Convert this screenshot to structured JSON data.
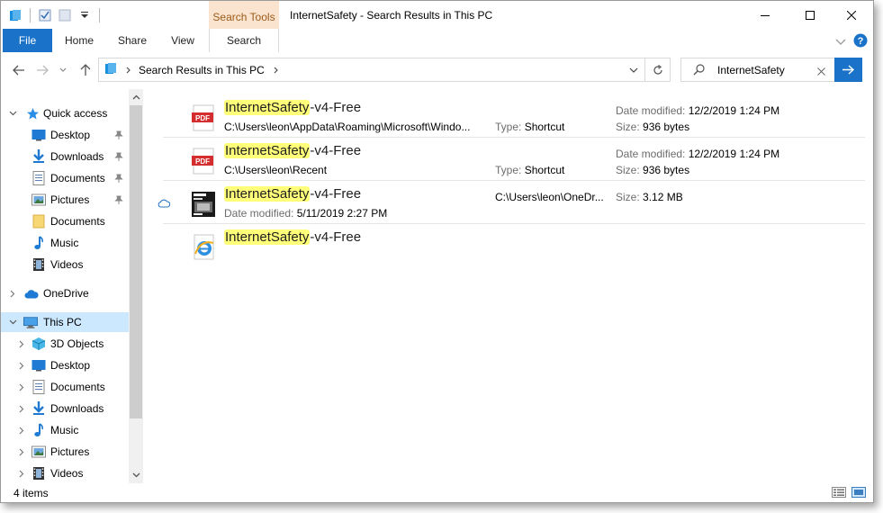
{
  "window": {
    "title": "InternetSafety - Search Results in This PC"
  },
  "ribbon": {
    "context_header": "Search Tools",
    "tabs": [
      "File",
      "Home",
      "Share",
      "View",
      "Search"
    ]
  },
  "address": {
    "breadcrumb": "Search Results in This PC"
  },
  "search": {
    "value": "InternetSafety"
  },
  "nav": {
    "quick_access": "Quick access",
    "quick_items": [
      "Desktop",
      "Downloads",
      "Documents",
      "Pictures",
      "Documents",
      "Music",
      "Videos"
    ],
    "onedrive": "OneDrive",
    "this_pc": "This PC",
    "pc_items": [
      "3D Objects",
      "Desktop",
      "Documents",
      "Downloads",
      "Music",
      "Pictures",
      "Videos"
    ]
  },
  "results": [
    {
      "name_highlight": "InternetSafety",
      "name_rest": "-v4-Free",
      "icon": "pdf-shortcut-icon",
      "path": "C:\\Users\\leon\\AppData\\Roaming\\Microsoft\\Windo...",
      "type_label": "Type:",
      "type": "Shortcut",
      "date_label": "Date modified:",
      "date": "12/2/2019 1:24 PM",
      "size_label": "Size:",
      "size": "936 bytes"
    },
    {
      "name_highlight": "InternetSafety",
      "name_rest": "-v4-Free",
      "icon": "pdf-shortcut-icon",
      "path": "C:\\Users\\leon\\Recent",
      "type_label": "Type:",
      "type": "Shortcut",
      "date_label": "Date modified:",
      "date": "12/2/2019 1:24 PM",
      "size_label": "Size:",
      "size": "936 bytes"
    },
    {
      "name_highlight": "InternetSafety",
      "name_rest": "-v4-Free",
      "icon": "document-thumbnail-icon",
      "date_label": "Date modified:",
      "date": "5/11/2019 2:27 PM",
      "path": "C:\\Users\\leon\\OneDr...",
      "size_label": "Size:",
      "size": "3.12 MB"
    },
    {
      "name_highlight": "InternetSafety",
      "name_rest": "-v4-Free",
      "icon": "internet-explorer-icon"
    }
  ],
  "status": {
    "item_count": "4 items"
  },
  "colors": {
    "accent": "#1a73c9",
    "highlight": "#ffff7a",
    "selected": "#cce8ff",
    "context_tab": "#fbe4cf"
  }
}
